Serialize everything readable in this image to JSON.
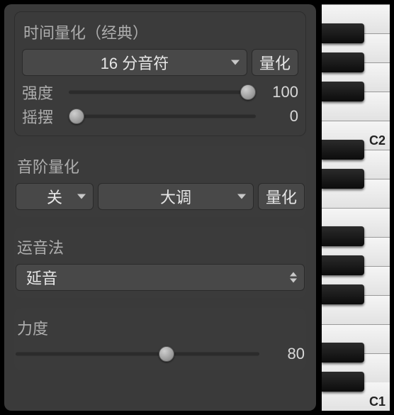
{
  "timeQuantize": {
    "title": "时间量化（经典）",
    "resolution": "16 分音符",
    "button": "量化",
    "strength": {
      "label": "强度",
      "value": 100,
      "pct": 100
    },
    "swing": {
      "label": "摇摆",
      "value": 0,
      "pct": 0
    }
  },
  "scaleQuantize": {
    "title": "音阶量化",
    "root": "关",
    "scale": "大调",
    "button": "量化"
  },
  "articulation": {
    "title": "运音法",
    "value": "延音"
  },
  "velocity": {
    "title": "力度",
    "value": 80,
    "pct": 63
  },
  "piano": {
    "labels": {
      "c1": "C1",
      "c2": "C2"
    }
  }
}
